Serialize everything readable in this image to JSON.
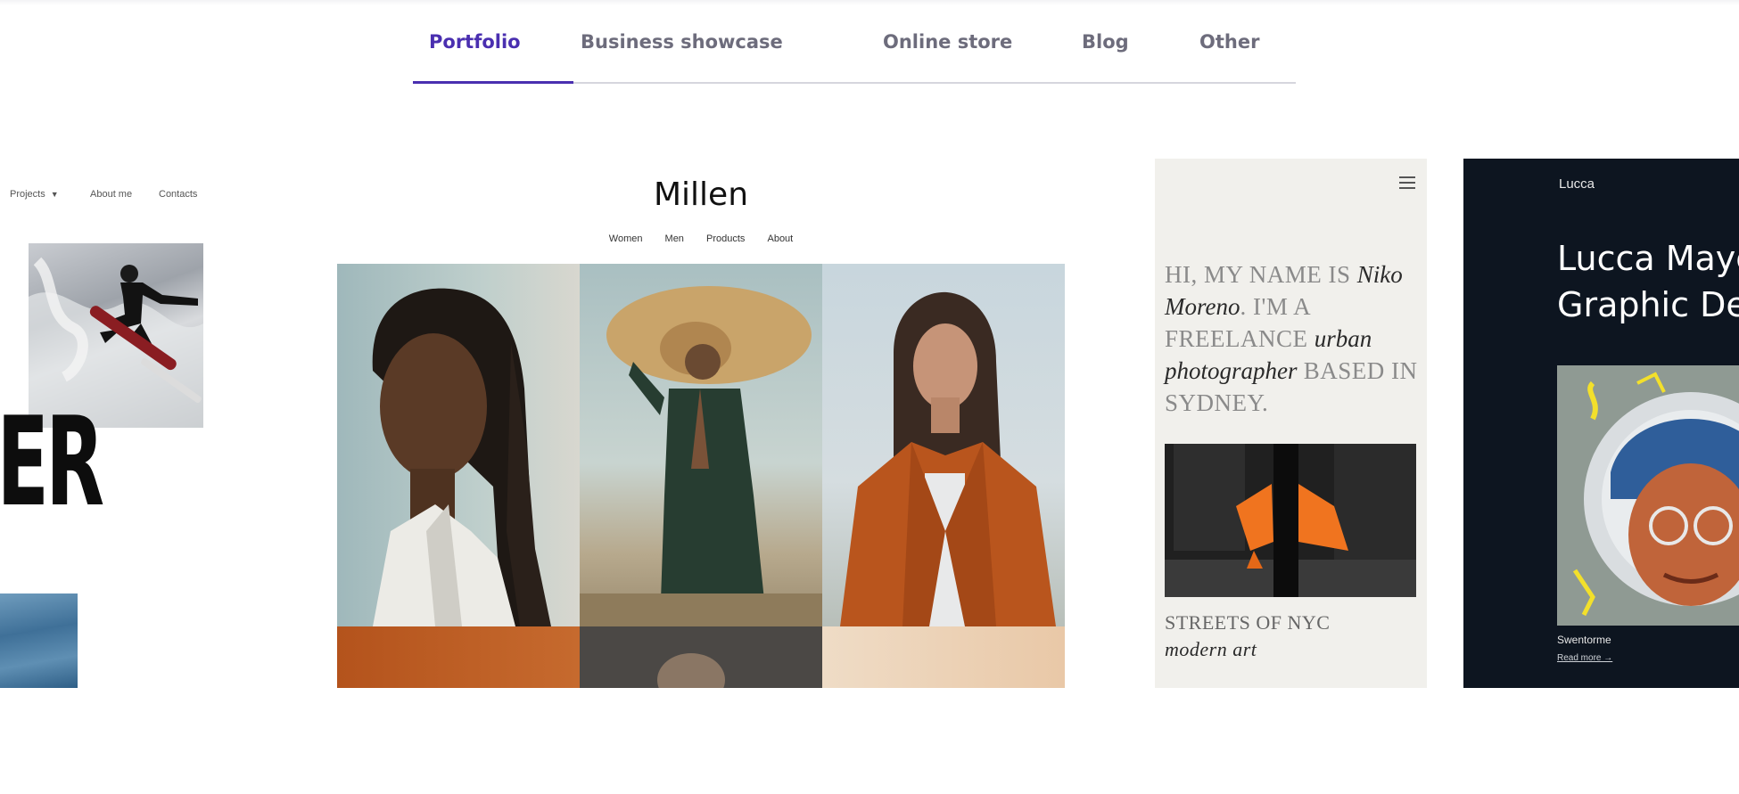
{
  "tabs": {
    "items": [
      {
        "label": "Portfolio",
        "active": true
      },
      {
        "label": "Business showcase",
        "active": false
      },
      {
        "label": "Online store",
        "active": false
      },
      {
        "label": "Blog",
        "active": false
      },
      {
        "label": "Other",
        "active": false
      }
    ],
    "accent_color": "#4a2fb0"
  },
  "cards": {
    "left": {
      "nav": [
        "Projects",
        "About me",
        "Contacts"
      ],
      "headline": "GER\nY"
    },
    "millen": {
      "title": "Millen",
      "nav": [
        "Women",
        "Men",
        "Products",
        "About"
      ]
    },
    "niko": {
      "bio_intro": "HI, MY NAME IS",
      "bio_name": "Niko Moreno",
      "bio_mid": ". I'M A FREELANCE",
      "bio_role": "urban photographer",
      "bio_end": "BASED IN SYDNEY.",
      "caption_line1": "STREETS OF NYC",
      "caption_line2": "modern art"
    },
    "lucca": {
      "logo": "Lucca",
      "headline": "Lucca Maye\nGraphic De",
      "caption": "Swentorme",
      "link": "Read more →"
    }
  }
}
